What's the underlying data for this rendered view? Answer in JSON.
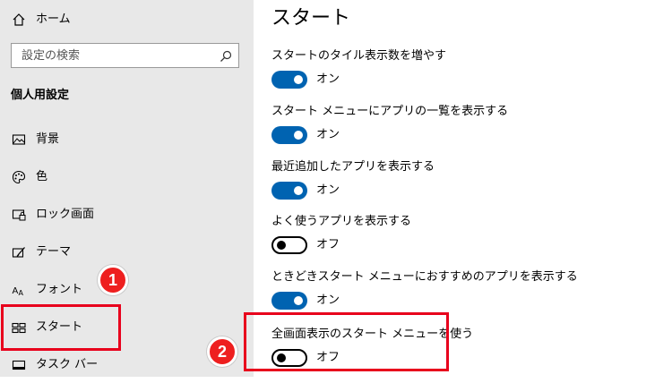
{
  "sidebar": {
    "home_label": "ホーム",
    "search_placeholder": "設定の検索",
    "section_heading": "個人用設定",
    "items": [
      {
        "label": "背景",
        "icon": "image-icon"
      },
      {
        "label": "色",
        "icon": "palette-icon"
      },
      {
        "label": "ロック画面",
        "icon": "lock-screen-icon"
      },
      {
        "label": "テーマ",
        "icon": "theme-icon"
      },
      {
        "label": "フォント",
        "icon": "font-icon"
      },
      {
        "label": "スタート",
        "icon": "start-icon"
      },
      {
        "label": "タスク バー",
        "icon": "taskbar-icon"
      }
    ]
  },
  "main": {
    "title": "スタート",
    "settings": [
      {
        "label": "スタートのタイル表示数を増やす",
        "state": "オン",
        "on": true
      },
      {
        "label": "スタート メニューにアプリの一覧を表示する",
        "state": "オン",
        "on": true
      },
      {
        "label": "最近追加したアプリを表示する",
        "state": "オン",
        "on": true
      },
      {
        "label": "よく使うアプリを表示する",
        "state": "オフ",
        "on": false
      },
      {
        "label": "ときどきスタート メニューにおすすめのアプリを表示する",
        "state": "オン",
        "on": true
      },
      {
        "label": "全画面表示のスタート メニューを使う",
        "state": "オフ",
        "on": false
      }
    ]
  },
  "annotations": {
    "badge_1": "1",
    "badge_2": "2",
    "color": "#e8001c"
  },
  "colors": {
    "toggle_on": "#0063b1",
    "sidebar_bg": "#e8e8e8"
  }
}
